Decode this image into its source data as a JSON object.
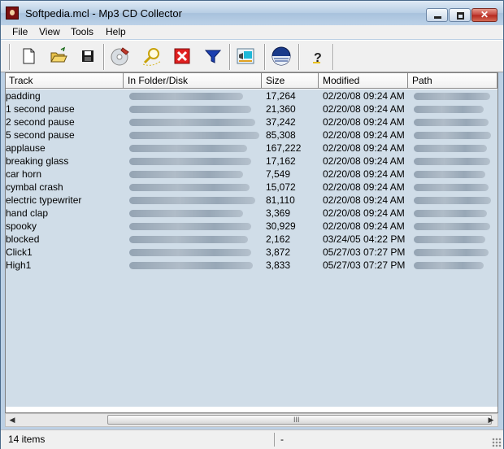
{
  "window": {
    "title": "Softpedia.mcl - Mp3 CD Collector"
  },
  "menu": [
    "File",
    "View",
    "Tools",
    "Help"
  ],
  "toolbar": {
    "icons": [
      "new-file-icon",
      "open-folder-icon",
      "save-disk-icon",
      "scan-cd-icon",
      "search-icon",
      "delete-icon",
      "filter-icon",
      "player-icon",
      "disc-icon",
      "help-icon"
    ]
  },
  "columns": [
    "Track",
    "In Folder/Disk",
    "Size",
    "Modified",
    "Path"
  ],
  "rows": [
    {
      "track": "padding",
      "size": "17,264",
      "modified": "02/20/08 09:24 AM"
    },
    {
      "track": "1 second pause",
      "size": "21,360",
      "modified": "02/20/08 09:24 AM"
    },
    {
      "track": "2 second pause",
      "size": "37,242",
      "modified": "02/20/08 09:24 AM"
    },
    {
      "track": "5 second pause",
      "size": "85,308",
      "modified": "02/20/08 09:24 AM"
    },
    {
      "track": "applause",
      "size": "167,222",
      "modified": "02/20/08 09:24 AM"
    },
    {
      "track": "breaking glass",
      "size": "17,162",
      "modified": "02/20/08 09:24 AM"
    },
    {
      "track": "car horn",
      "size": "7,549",
      "modified": "02/20/08 09:24 AM"
    },
    {
      "track": "cymbal crash",
      "size": "15,072",
      "modified": "02/20/08 09:24 AM"
    },
    {
      "track": "electric typewriter",
      "size": "81,110",
      "modified": "02/20/08 09:24 AM"
    },
    {
      "track": "hand clap",
      "size": "3,369",
      "modified": "02/20/08 09:24 AM"
    },
    {
      "track": "spooky",
      "size": "30,929",
      "modified": "02/20/08 09:24 AM"
    },
    {
      "track": "blocked",
      "size": "2,162",
      "modified": "03/24/05 04:22 PM"
    },
    {
      "track": "Click1",
      "size": "3,872",
      "modified": "05/27/03 07:27 PM"
    },
    {
      "track": "High1",
      "size": "3,833",
      "modified": "05/27/03 07:27 PM"
    }
  ],
  "scrollbar": {
    "grip": "III"
  },
  "status": {
    "count": "14 items",
    "right": "-"
  }
}
